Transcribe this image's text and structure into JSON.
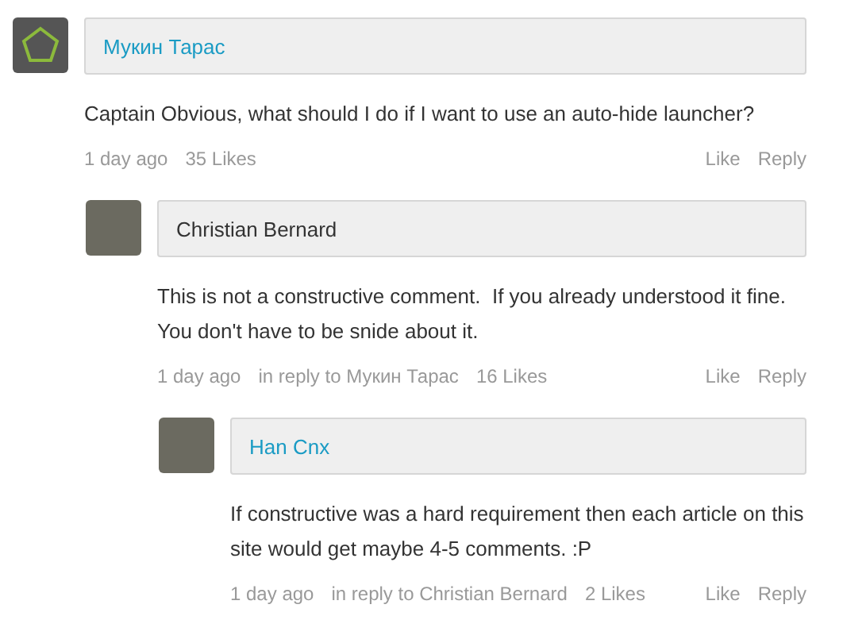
{
  "comments": [
    {
      "author": "Мукин Тарас",
      "author_linked": true,
      "kind": "pentagon",
      "body": "Captain Obvious, what should I do if I want to use an auto-hide launcher?",
      "time": "1 day ago",
      "likes": "35 Likes",
      "actions": [
        "Like",
        "Reply"
      ],
      "children": [
        {
          "author": "Christian Bernard",
          "author_linked": false,
          "kind": "photo",
          "body": "This is not a constructive comment.  If you already understood it fine. You don't have to be snide about it.",
          "time": "1 day ago",
          "reply_to": "in reply to Мукин Тарас",
          "likes": "16 Likes",
          "actions": [
            "Like",
            "Reply"
          ],
          "children": [
            {
              "author": "Han Cnx",
              "author_linked": true,
              "kind": "photo",
              "body": "If constructive was a hard requirement then each article on this site would get maybe 4-5 comments. :P",
              "time": "1 day ago",
              "reply_to": "in reply to Christian Bernard",
              "likes": "2 Likes",
              "actions": [
                "Like",
                "Reply"
              ]
            }
          ]
        }
      ]
    }
  ]
}
